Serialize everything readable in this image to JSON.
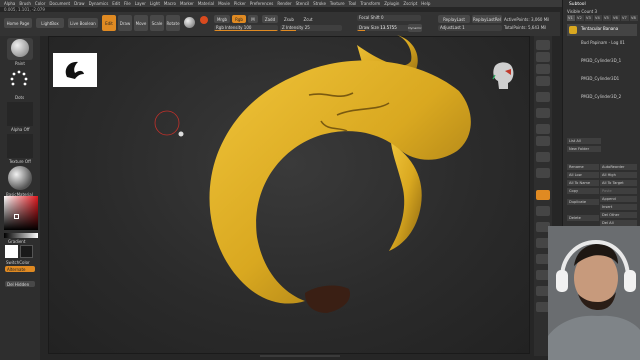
{
  "menu": [
    "Alpha",
    "Brush",
    "Color",
    "Document",
    "Draw",
    "Dynamics",
    "Edit",
    "File",
    "Layer",
    "Light",
    "Macro",
    "Marker",
    "Material",
    "Movie",
    "Picker",
    "Preferences",
    "Render",
    "Stencil",
    "Stroke",
    "Texture",
    "Tool",
    "Transform",
    "Zplugin",
    "Zscript",
    "Help"
  ],
  "coords": "0.005, 1.101, -2.079",
  "toolbar": {
    "home_page": "Home Page",
    "lightbox": "LightBox",
    "live_boolean": "Live Boolean",
    "edit": "Edit",
    "draw": "Draw",
    "move": "Move",
    "scale": "Scale",
    "rotate": "Rotate",
    "mrgb": "Mrgb",
    "rgb": "Rgb",
    "m": "M",
    "zadd": "Zadd",
    "zsub": "Zsub",
    "zcut": "Zcut",
    "rgb_intensity": "Rgb Intensity 100",
    "z_intensity": "Z Intensity 25",
    "focal_shift": "Focal Shift 0",
    "draw_size": "Draw Size",
    "draw_size_value": "13.5755",
    "dynamic": "Dynamic",
    "replay_last": "ReplayLast",
    "replay_last_rel": "ReplayLastRel",
    "adjust_last": "AdjustLast 1",
    "active_points": "ActivePoints: 3,060 Mil",
    "total_points": "TotalPoints: 5,643 Mil"
  },
  "left": {
    "brush": "Paint",
    "stroke": "Dots",
    "alpha": "Alpha Off",
    "texture": "Texture Off",
    "material": "BasicMaterial",
    "gradient": "Gradient",
    "switch_color": "SwitchColor",
    "alternate": "Alternate",
    "dot_hidden": "Del Hidden"
  },
  "subtool": {
    "title": "Subtool",
    "visible_count": "Visible Count 3",
    "slots": [
      "V1",
      "V2",
      "V3",
      "V4",
      "V5",
      "V6",
      "V7",
      "V8"
    ],
    "items": [
      "Tentacular Banana",
      "Bud Papinam - Log 01",
      "PM3D_Cylinder3D_1",
      "PM3D_Cylinder3D1",
      "PM3D_Cylinder3D_2"
    ],
    "list_all": "List All",
    "new_folder": "New Folder",
    "rename": "Rename",
    "auto_reorder": "AutoReorder",
    "all_low": "All Low",
    "all_high": "All High",
    "all_to_name": "All To Name",
    "all_to_target": "All To Target",
    "copy": "Copy",
    "paste": "Paste",
    "duplicate": "Duplicate",
    "append": "Append",
    "insert": "Insert",
    "delete": "Delete",
    "del_other": "Del Other",
    "del_all": "Del All"
  },
  "colors": {
    "accent": "#e08a22",
    "banana": "#d9a820",
    "main_color": "#ffffff",
    "secondary_color": "#1a1a1a"
  },
  "sliders": {
    "rgb_intensity": 1.0,
    "z_intensity": 0.25,
    "draw_size": 0.14
  }
}
